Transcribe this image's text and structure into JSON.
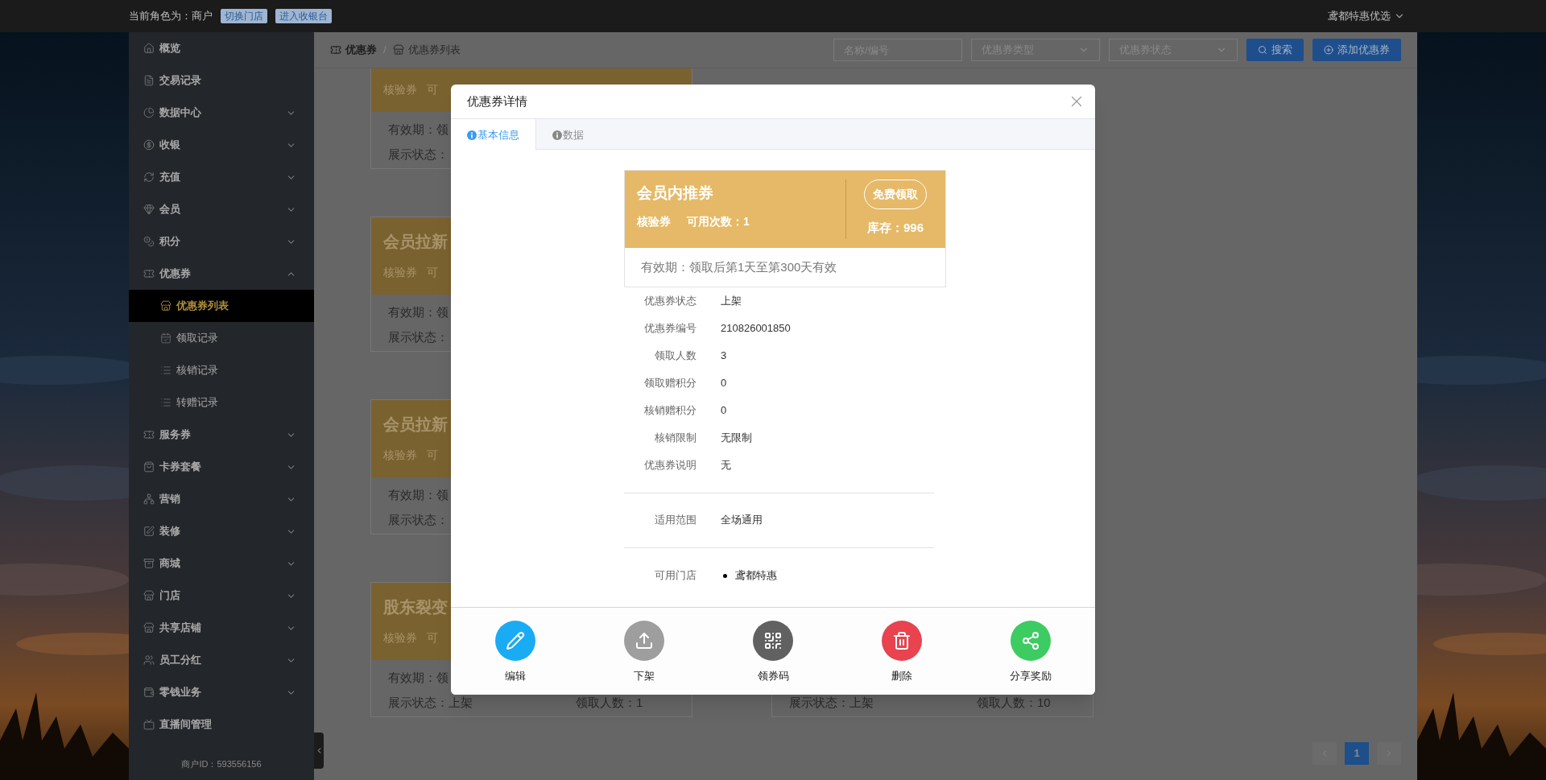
{
  "top_bar": {
    "role_label": "当前角色为：商户",
    "buttons": [
      "切换门店",
      "进入收银台"
    ],
    "account": "鸢都特惠优选"
  },
  "sidebar": {
    "items": [
      {
        "label": "概览",
        "kind": "link"
      },
      {
        "label": "交易记录",
        "kind": "link"
      },
      {
        "label": "数据中心",
        "kind": "group",
        "expanded": false
      },
      {
        "label": "收银",
        "kind": "group",
        "expanded": false
      },
      {
        "label": "充值",
        "kind": "group",
        "expanded": false
      },
      {
        "label": "会员",
        "kind": "group",
        "expanded": false
      },
      {
        "label": "积分",
        "kind": "group",
        "expanded": false
      },
      {
        "label": "优惠券",
        "kind": "group",
        "expanded": true,
        "children": [
          {
            "label": "优惠券列表",
            "selected": true
          },
          {
            "label": "领取记录",
            "selected": false
          },
          {
            "label": "核销记录",
            "selected": false
          },
          {
            "label": "转赠记录",
            "selected": false
          }
        ]
      },
      {
        "label": "服务券",
        "kind": "group",
        "expanded": false
      },
      {
        "label": "卡券套餐",
        "kind": "group",
        "expanded": false
      },
      {
        "label": "营销",
        "kind": "group",
        "expanded": false
      },
      {
        "label": "装修",
        "kind": "group",
        "expanded": false
      },
      {
        "label": "商城",
        "kind": "group",
        "expanded": false
      },
      {
        "label": "门店",
        "kind": "group",
        "expanded": false
      },
      {
        "label": "共享店铺",
        "kind": "group",
        "expanded": false
      },
      {
        "label": "员工分红",
        "kind": "group",
        "expanded": false
      },
      {
        "label": "零钱业务",
        "kind": "group",
        "expanded": false
      },
      {
        "label": "直播间管理",
        "kind": "link"
      }
    ],
    "merchant_id": "商户ID：593556156"
  },
  "header": {
    "breadcrumb": [
      "优惠券",
      "优惠券列表"
    ],
    "separator": "/",
    "filters": [
      {
        "kind": "input",
        "placeholder": "名称/编号"
      },
      {
        "kind": "select",
        "placeholder": "优惠券类型"
      },
      {
        "kind": "select",
        "placeholder": "优惠券状态"
      }
    ],
    "buttons": [
      {
        "label": "搜索",
        "kind": "search"
      },
      {
        "label": "添加优惠券",
        "kind": "add"
      }
    ]
  },
  "coupon_list": {
    "left": [
      {
        "type": "核验券",
        "uses": "可",
        "validity": "有效期：领",
        "display": "展示状态："
      },
      {
        "title": "会员拉新",
        "type": "核验券",
        "uses": "可",
        "validity": "有效期：领",
        "display": "展示状态："
      },
      {
        "title": "会员拉新",
        "type": "核验券",
        "uses": "可",
        "validity": "有效期：领",
        "display": "展示状态："
      },
      {
        "title": "股东裂变",
        "type": "核验券",
        "uses": "可",
        "validity": "有效期：领",
        "display": "展示状态：上架",
        "claimed": "领取人数：1"
      }
    ],
    "right": [
      {
        "display": "展示状态：上架",
        "claimed": "领取人数：10"
      }
    ]
  },
  "pagination": {
    "pages": [
      {
        "label": "1",
        "selected": true
      }
    ]
  },
  "modal": {
    "title": "优惠券详情",
    "tabs": [
      {
        "label": "基本信息",
        "selected": true
      },
      {
        "label": "数据",
        "selected": false
      }
    ],
    "coupon": {
      "name": "会员内推券",
      "type": "核验券",
      "uses": "可用次数：1",
      "claim_button": "免费领取",
      "stock": "库存：996",
      "validity": "有效期：领取后第1天至第300天有效"
    },
    "details": [
      {
        "label": "优惠券状态",
        "value": "上架"
      },
      {
        "label": "优惠券编号",
        "value": "210826001850"
      },
      {
        "label": "领取人数",
        "value": "3"
      },
      {
        "label": "领取赠积分",
        "value": "0"
      },
      {
        "label": "核销赠积分",
        "value": "0"
      },
      {
        "label": "核销限制",
        "value": "无限制"
      },
      {
        "label": "优惠券说明",
        "value": "无"
      }
    ],
    "scope": {
      "label": "适用范围",
      "value": "全场通用"
    },
    "stores": {
      "label": "可用门店",
      "items": [
        "鸢都特惠"
      ]
    },
    "actions": [
      {
        "label": "编辑",
        "kind": "edit",
        "color": "#1aabf5"
      },
      {
        "label": "下架",
        "kind": "unpublish",
        "color": "#9e9e9e"
      },
      {
        "label": "领券码",
        "kind": "code",
        "color": "#616161"
      },
      {
        "label": "删除",
        "kind": "delete",
        "color": "#e8434f"
      },
      {
        "label": "分享奖励",
        "kind": "share",
        "color": "#3dcc62"
      }
    ]
  }
}
